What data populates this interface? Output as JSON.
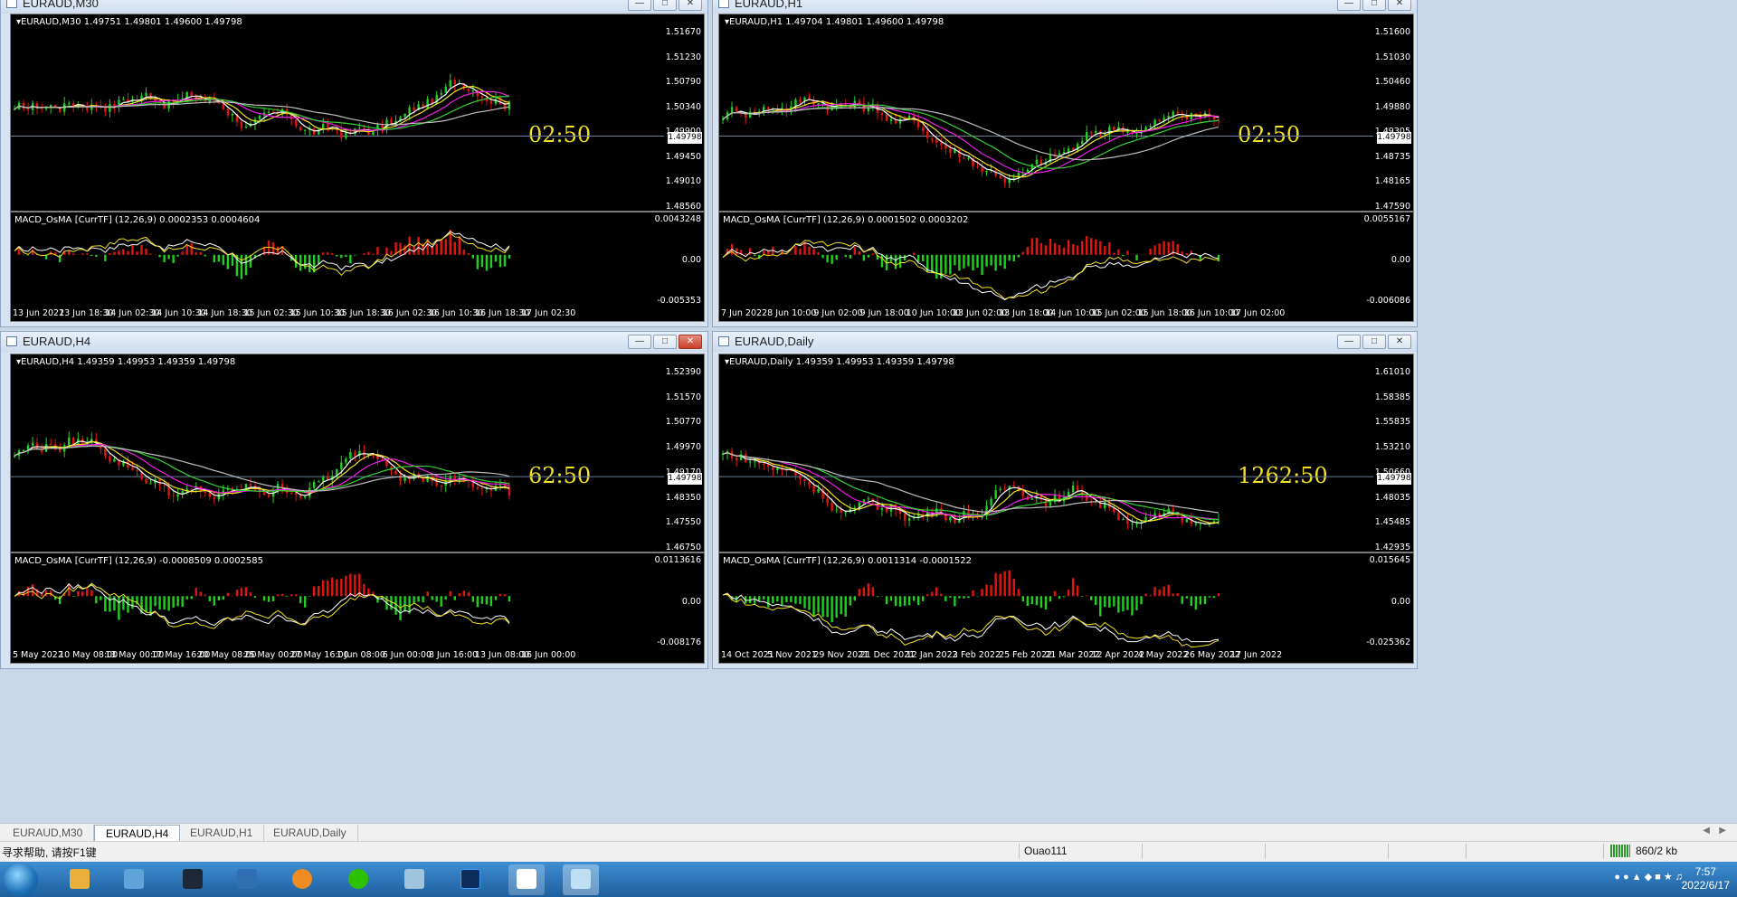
{
  "colors": {
    "bull": "#1fd11f",
    "bear": "#e3150f",
    "ma_fast": "#ffffff",
    "ma_yellow": "#f3e21f",
    "ma_magenta": "#f01ce8",
    "ma_green": "#32d232",
    "ma_gray": "#bdbdbd",
    "timer": "#f3e21f",
    "chart_bg": "#000000"
  },
  "windows": [
    {
      "id": "m30",
      "title": "EURAUD,M30",
      "ohlc": "EURAUD,M30  1.49751 1.49801 1.49600 1.49798",
      "macd_label": "MACD_OsMA [CurrTF] (12,26,9) 0.0002353 0.0004604",
      "price_ticks": [
        "1.51670",
        "1.51230",
        "1.50790",
        "1.50340",
        "1.49900",
        "1.49450",
        "1.49010",
        "1.48560"
      ],
      "current_price": "1.49798",
      "macd_ticks": [
        "0.0043248",
        "0.00",
        "-0.005353"
      ],
      "timer": "02:50",
      "time_labels": [
        "13 Jun 2022",
        "13 Jun 18:30",
        "14 Jun 02:30",
        "14 Jun 10:30",
        "14 Jun 18:30",
        "15 Jun 02:30",
        "15 Jun 10:30",
        "15 Jun 18:30",
        "16 Jun 02:30",
        "16 Jun 10:30",
        "16 Jun 18:30",
        "17 Jun 02:30"
      ],
      "buttons": [
        "minimize",
        "maximize",
        "close"
      ]
    },
    {
      "id": "h1",
      "title": "EURAUD,H1",
      "ohlc": "EURAUD,H1  1.49704 1.49801 1.49600 1.49798",
      "macd_label": "MACD_OsMA [CurrTF] (12,26,9) 0.0001502 0.0003202",
      "price_ticks": [
        "1.51600",
        "1.51030",
        "1.50460",
        "1.49880",
        "1.49305",
        "1.48735",
        "1.48165",
        "1.47590"
      ],
      "current_price": "1.49798",
      "macd_ticks": [
        "0.0055167",
        "0.00",
        "-0.006086"
      ],
      "timer": "02:50",
      "time_labels": [
        "7 Jun 2022",
        "8 Jun 10:00",
        "9 Jun 02:00",
        "9 Jun 18:00",
        "10 Jun 10:00",
        "13 Jun 02:00",
        "13 Jun 18:00",
        "14 Jun 10:00",
        "15 Jun 02:00",
        "15 Jun 18:00",
        "16 Jun 10:00",
        "17 Jun 02:00"
      ],
      "buttons": [
        "minimize",
        "maximize",
        "close"
      ]
    },
    {
      "id": "h4",
      "title": "EURAUD,H4",
      "ohlc": "EURAUD,H4  1.49359 1.49953 1.49359 1.49798",
      "macd_label": "MACD_OsMA [CurrTF] (12,26,9) -0.0008509 0.0002585",
      "price_ticks": [
        "1.52390",
        "1.51570",
        "1.50770",
        "1.49970",
        "1.49170",
        "1.48350",
        "1.47550",
        "1.46750"
      ],
      "current_price": "1.49798",
      "macd_ticks": [
        "0.0113616",
        "0.00",
        "-0.008176"
      ],
      "timer": "62:50",
      "time_labels": [
        "5 May 2022",
        "10 May 08:00",
        "13 May 00:00",
        "17 May 16:00",
        "20 May 08:00",
        "25 May 00:00",
        "27 May 16:00",
        "1 Jun 08:00",
        "6 Jun 00:00",
        "8 Jun 16:00",
        "13 Jun 08:00",
        "16 Jun 00:00"
      ],
      "buttons": [
        "minimize",
        "maximize",
        "close"
      ]
    },
    {
      "id": "d1",
      "title": "EURAUD,Daily",
      "ohlc": "EURAUD,Daily  1.49359 1.49953 1.49359 1.49798",
      "macd_label": "MACD_OsMA [CurrTF] (12,26,9) 0.0011314 -0.0001522",
      "price_ticks": [
        "1.61010",
        "1.58385",
        "1.55835",
        "1.53210",
        "1.50660",
        "1.48035",
        "1.45485",
        "1.42935"
      ],
      "current_price": "1.49798",
      "macd_ticks": [
        "0.015645",
        "0.00",
        "-0.025362"
      ],
      "timer": "1262:50",
      "time_labels": [
        "14 Oct 2021",
        "5 Nov 2021",
        "29 Nov 2021",
        "21 Dec 2021",
        "12 Jan 2022",
        "3 Feb 2022",
        "25 Feb 2022",
        "21 Mar 2022",
        "12 Apr 2022",
        "4 May 2022",
        "26 May 2022",
        "17 Jun 2022"
      ],
      "buttons": [
        "minimize",
        "maximize",
        "close"
      ]
    }
  ],
  "tabs": [
    "EURAUD,M30",
    "EURAUD,H4",
    "EURAUD,H1",
    "EURAUD,Daily"
  ],
  "active_tab": "EURAUD,H4",
  "status": {
    "help": "寻求帮助, 请按F1键",
    "profile": "Ouao111",
    "traffic": "860/2 kb"
  },
  "taskbar": {
    "apps": [
      "windows-explorer",
      "contacts",
      "zte",
      "remote-desktop",
      "browser",
      "wechat",
      "notepad",
      "photoshop",
      "pen-tool",
      "chart-app"
    ],
    "time": "7:57",
    "date": "2022/6/17"
  }
}
